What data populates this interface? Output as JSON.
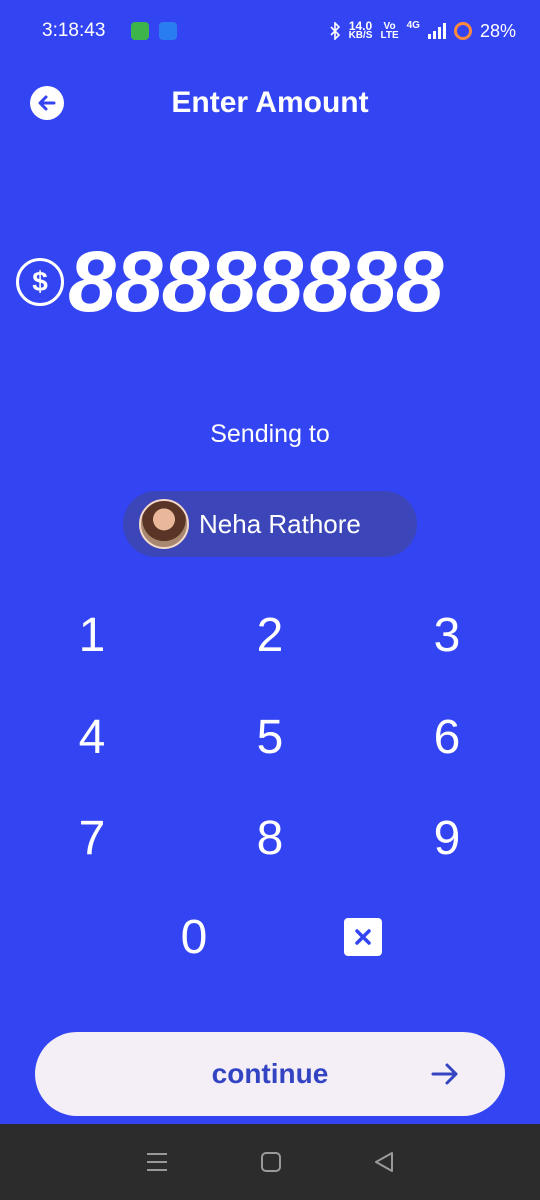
{
  "status_bar": {
    "time": "3:18:43",
    "net_speed_top": "14.0",
    "net_speed_bottom": "KB/S",
    "volte_top": "Vo",
    "volte_bottom": "LTE",
    "network": "4G",
    "battery": "28%"
  },
  "header": {
    "title": "Enter Amount"
  },
  "amount": {
    "currency_symbol": "$",
    "value": "88888888"
  },
  "recipient": {
    "label": "Sending to",
    "name": "Neha Rathore"
  },
  "keypad": {
    "keys": [
      "1",
      "2",
      "3",
      "4",
      "5",
      "6",
      "7",
      "8",
      "9",
      "0"
    ]
  },
  "continue": {
    "label": "continue"
  },
  "colors": {
    "background": "#3344f2",
    "chip": "#3c46b8",
    "button": "#f4eff7",
    "button_text": "#3344c2"
  }
}
